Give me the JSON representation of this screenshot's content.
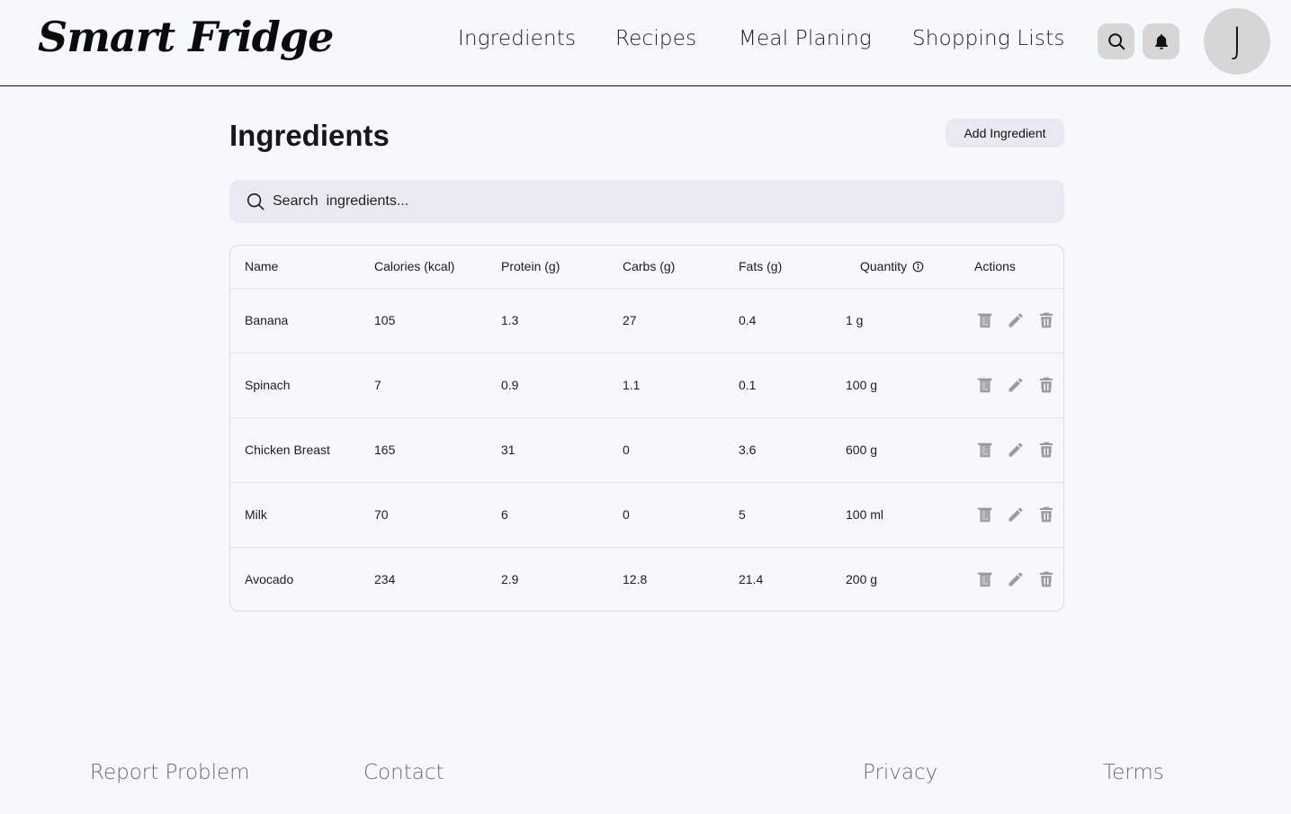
{
  "header": {
    "logo": "Smart Fridge",
    "nav": [
      {
        "label": "Ingredients"
      },
      {
        "label": "Recipes"
      },
      {
        "label": "Meal Planing"
      },
      {
        "label": "Shopping Lists"
      }
    ],
    "search_icon": "search-icon",
    "notification_icon": "bell-icon",
    "avatar_initial": "J"
  },
  "main": {
    "title": "Ingredients",
    "add_button_label": "Add Ingredient",
    "search": {
      "placeholder": "Search  ingredients...",
      "value": ""
    },
    "table": {
      "columns": [
        "Name",
        "Calories (kcal)",
        "Protein (g)",
        "Carbs (g)",
        "Fats (g)",
        "Quantity",
        "Actions"
      ],
      "quantity_info_icon": "info-icon",
      "rows": [
        {
          "name": "Banana",
          "calories": "105",
          "protein": "1.3",
          "carbs": "27",
          "fats": "0.4",
          "quantity": "1 g"
        },
        {
          "name": "Spinach",
          "calories": "7",
          "protein": "0.9",
          "carbs": "1.1",
          "fats": "0.1",
          "quantity": "100 g"
        },
        {
          "name": "Chicken Breast",
          "calories": "165",
          "protein": "31",
          "carbs": "0",
          "fats": "3.6",
          "quantity": "600 g"
        },
        {
          "name": "Milk",
          "calories": "70",
          "protein": "6",
          "carbs": "0",
          "fats": "5",
          "quantity": "100 ml"
        },
        {
          "name": "Avocado",
          "calories": "234",
          "protein": "2.9",
          "carbs": "12.8",
          "fats": "21.4",
          "quantity": "200 g"
        }
      ],
      "row_actions": [
        "measuring-cup-icon",
        "pencil-icon",
        "trash-icon"
      ]
    }
  },
  "footer": {
    "links": [
      {
        "label": "Report Problem"
      },
      {
        "label": "Contact"
      },
      {
        "label": "Privacy"
      },
      {
        "label": "Terms"
      }
    ]
  },
  "colors": {
    "background": "#f5f9fc",
    "icon_button_bg": "#d6d6d6",
    "action_icon": "#9a9a9a",
    "search_bg": "#e7eaf1",
    "footer_text": "#6b6b6b"
  }
}
